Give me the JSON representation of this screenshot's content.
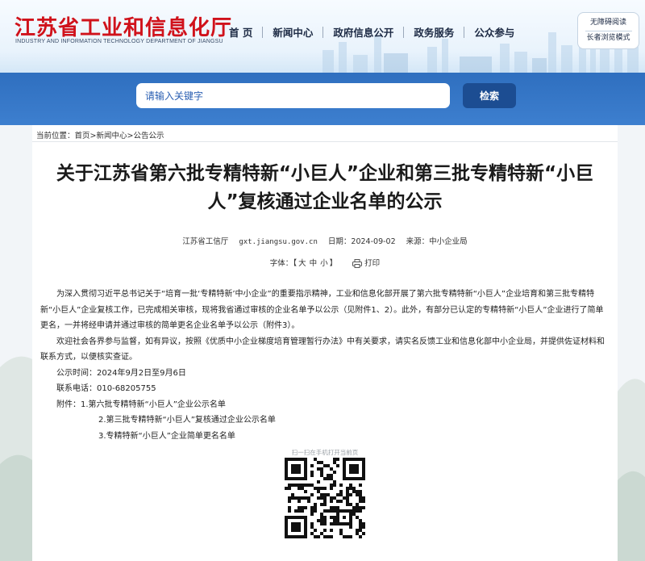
{
  "header": {
    "site_title_cn": "江苏省工业和信息化厅",
    "site_title_en": "INDUSTRY AND INFORMATION TECHNOLOGY DEPARTMENT OF JIANGSU",
    "nav": [
      "首 页",
      "新闻中心",
      "政府信息公开",
      "政务服务",
      "公众参与"
    ],
    "accessibility": {
      "barrier_free": "无障碍阅读",
      "elder_mode": "长者浏览模式"
    }
  },
  "search": {
    "placeholder": "请输入关键字",
    "button": "检索"
  },
  "breadcrumb": {
    "prefix": "当前位置：",
    "items": [
      "首页",
      "新闻中心",
      "公告公示"
    ],
    "separator": ">"
  },
  "article": {
    "title": "关于江苏省第六批专精特新“小巨人”企业和第三批专精特新“小巨人”复核通过企业名单的公示",
    "meta": {
      "source": "江苏省工信厅",
      "site": "gxt.jiangsu.gov.cn",
      "date": "日期：2024-09-02",
      "origin": "来源：中小企业局"
    },
    "font_size": {
      "label": "字体：",
      "open": "【",
      "options": [
        "大",
        "中",
        "小"
      ],
      "close": "】"
    },
    "print": "打印",
    "paragraphs": [
      "为深入贯彻习近平总书记关于“培育一批‘专精特新’中小企业”的重要指示精神，工业和信息化部开展了第六批专精特新“小巨人”企业培育和第三批专精特新“小巨人”企业复核工作，已完成相关审核，现将我省通过审核的企业名单予以公示（见附件1、2）。此外，有部分已认定的专精特新“小巨人”企业进行了简单更名，一并将经申请并通过审核的简单更名企业名单予以公示（附件3）。",
      "欢迎社会各界参与监督，如有异议，按照《优质中小企业梯度培育管理暂行办法》中有关要求，请实名反馈工业和信息化部中小企业局，并提供佐证材料和联系方式，以便核实查证。"
    ],
    "period": "公示时间：2024年9月2日至9月6日",
    "phone": "联系电话：010-68205755",
    "attachments_label": "附件：",
    "attachments": [
      "1.第六批专精特新“小巨人”企业公示名单",
      "2.第三批专精特新“小巨人”复核通过企业公示名单",
      "3.专精特新“小巨人”企业简单更名名单"
    ],
    "qr_caption": "扫一扫在手机打开当前页"
  },
  "colors": {
    "brand_red": "#d0121b",
    "band_blue": "#3575c5",
    "button_navy": "#1c4d92"
  },
  "icons": [
    "printer-icon",
    "qr-code-icon"
  ]
}
